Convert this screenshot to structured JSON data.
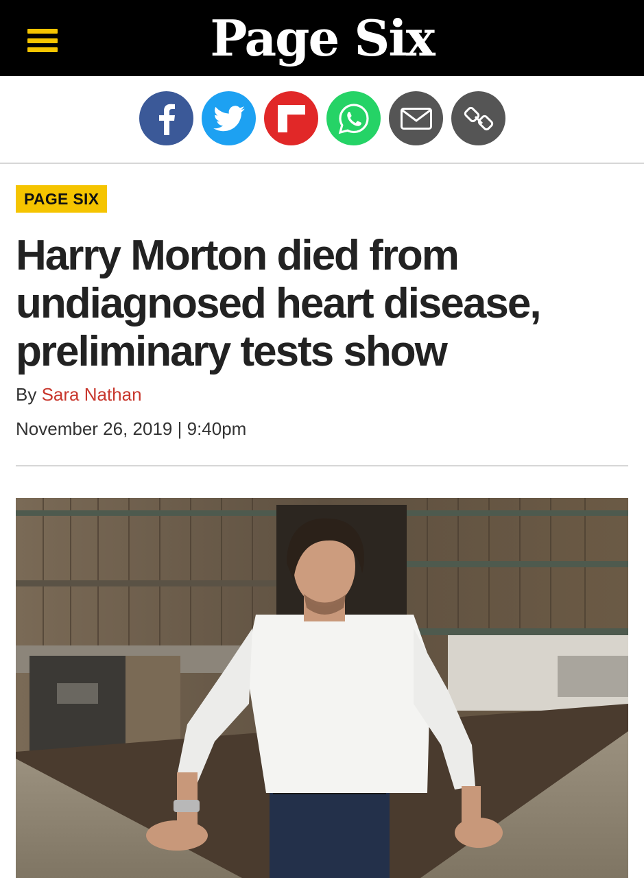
{
  "header": {
    "logo_text": "Page Six",
    "menu_icon": "hamburger-menu-icon",
    "accent_color": "#f5c400",
    "background_color": "#000000"
  },
  "share": {
    "buttons": [
      {
        "name": "facebook",
        "icon": "facebook-icon",
        "color": "#3b5998"
      },
      {
        "name": "twitter",
        "icon": "twitter-icon",
        "color": "#1da1f2"
      },
      {
        "name": "flipboard",
        "icon": "flipboard-icon",
        "color": "#e12828"
      },
      {
        "name": "whatsapp",
        "icon": "whatsapp-icon",
        "color": "#25d366"
      },
      {
        "name": "email",
        "icon": "email-icon",
        "color": "#555555"
      },
      {
        "name": "copy-link",
        "icon": "link-icon",
        "color": "#555555"
      }
    ]
  },
  "article": {
    "section_tag": "PAGE SIX",
    "headline": "Harry Morton died from undiagnosed heart disease, preliminary tests show",
    "byline_prefix": "By",
    "author": "Sara Nathan",
    "date": "November 26, 2019",
    "separator": "|",
    "time": "9:40pm"
  }
}
